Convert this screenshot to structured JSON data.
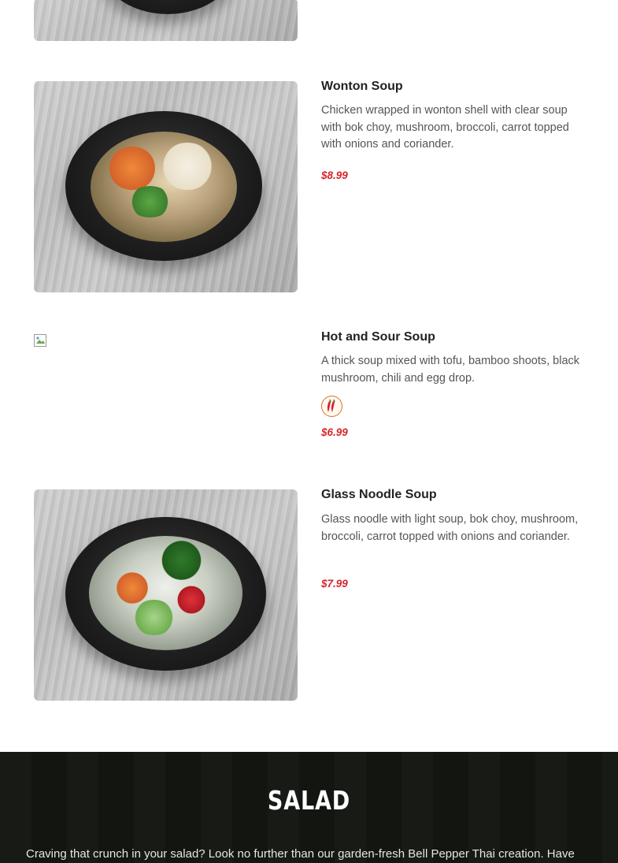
{
  "menu": {
    "items": [
      {
        "name": "Wonton Soup",
        "description": "Chicken wrapped in wonton shell with clear soup with bok choy, mushroom, broccoli, carrot topped with onions and coriander.",
        "price": "$8.99",
        "has_photo": true,
        "spicy": false
      },
      {
        "name": "Hot and Sour Soup",
        "description": "A thick soup mixed with tofu, bamboo shoots, black mushroom, chili and egg drop.",
        "price": "$6.99",
        "has_photo": false,
        "spicy": true,
        "spicy_icon": "chili-pepper-icon"
      },
      {
        "name": "Glass Noodle Soup",
        "description": "Glass noodle with light soup, bok choy, mushroom, broccoli, carrot topped with onions and coriander.",
        "price": "$7.99",
        "has_photo": true,
        "spicy": false
      }
    ]
  },
  "section": {
    "title": "SALAD",
    "intro": "Craving that crunch in your salad? Look no further than our garden-fresh Bell Pepper Thai creation. Have"
  },
  "colors": {
    "price": "#d8232a",
    "section_bg": "#141611",
    "spicy_border": "#d8742a"
  }
}
